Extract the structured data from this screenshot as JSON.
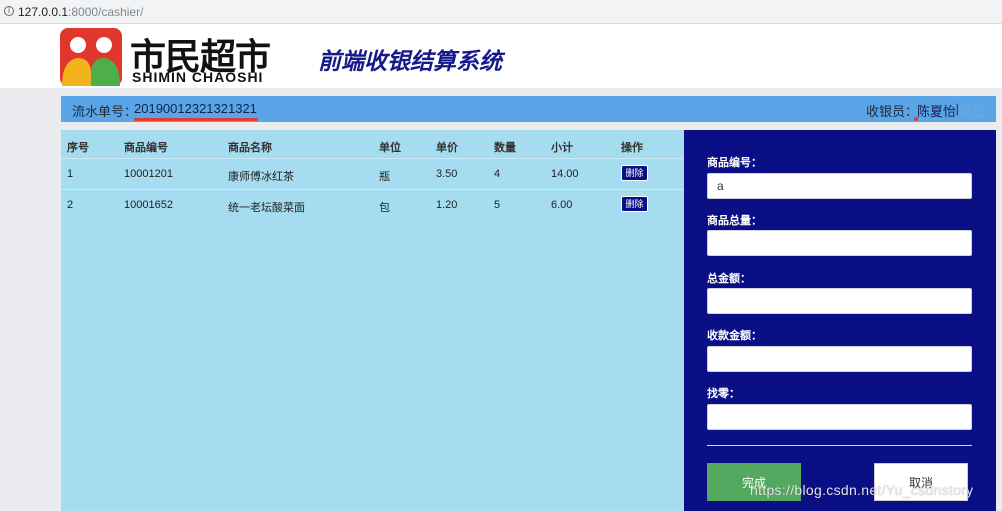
{
  "browser": {
    "url_host": "127.0.0.1",
    "url_rest": ":8000/cashier/"
  },
  "header": {
    "logo_cn": "市民超市",
    "logo_en": "SHIMIN CHAOSHI",
    "system_title": "前端收银结算系统"
  },
  "infobar": {
    "serial_label": "流水单号：",
    "serial_value": "20190012321321321",
    "cashier_label": "收银员：",
    "cashier_name": "陈夏怡",
    "divider": "|",
    "logout": "退出"
  },
  "table": {
    "columns": [
      "序号",
      "商品编号",
      "商品名称",
      "单位",
      "单价",
      "数量",
      "小计",
      "操作"
    ],
    "rows": [
      {
        "index": "1",
        "code": "10001201",
        "name": "康师傅冰红茶",
        "unit": "瓶",
        "price": "3.50",
        "qty": "4",
        "subtotal": "14.00",
        "action": "删除"
      },
      {
        "index": "2",
        "code": "10001652",
        "name": "统一老坛酸菜面",
        "unit": "包",
        "price": "1.20",
        "qty": "5",
        "subtotal": "6.00",
        "action": "删除"
      }
    ]
  },
  "form": {
    "product_code_label": "商品编号：",
    "product_code_value": "a",
    "total_qty_label": "商品总量：",
    "total_qty_value": "",
    "total_amount_label": "总金额：",
    "total_amount_value": "",
    "received_label": "收款金额：",
    "received_value": "",
    "change_label": "找零：",
    "change_value": "",
    "done_button": "完成",
    "cancel_button": "取消"
  },
  "watermark": "https://blog.csdn.net/Yu_csdnstory",
  "colors": {
    "infobar": "#5aa5e8",
    "table_bg": "#a6dcef",
    "form_bg": "#0a0f86",
    "title": "#141a8a",
    "done_button": "#55a860",
    "underline": "#e23b2f"
  },
  "icons": [
    "info-icon",
    "logo-mark-icon"
  ]
}
